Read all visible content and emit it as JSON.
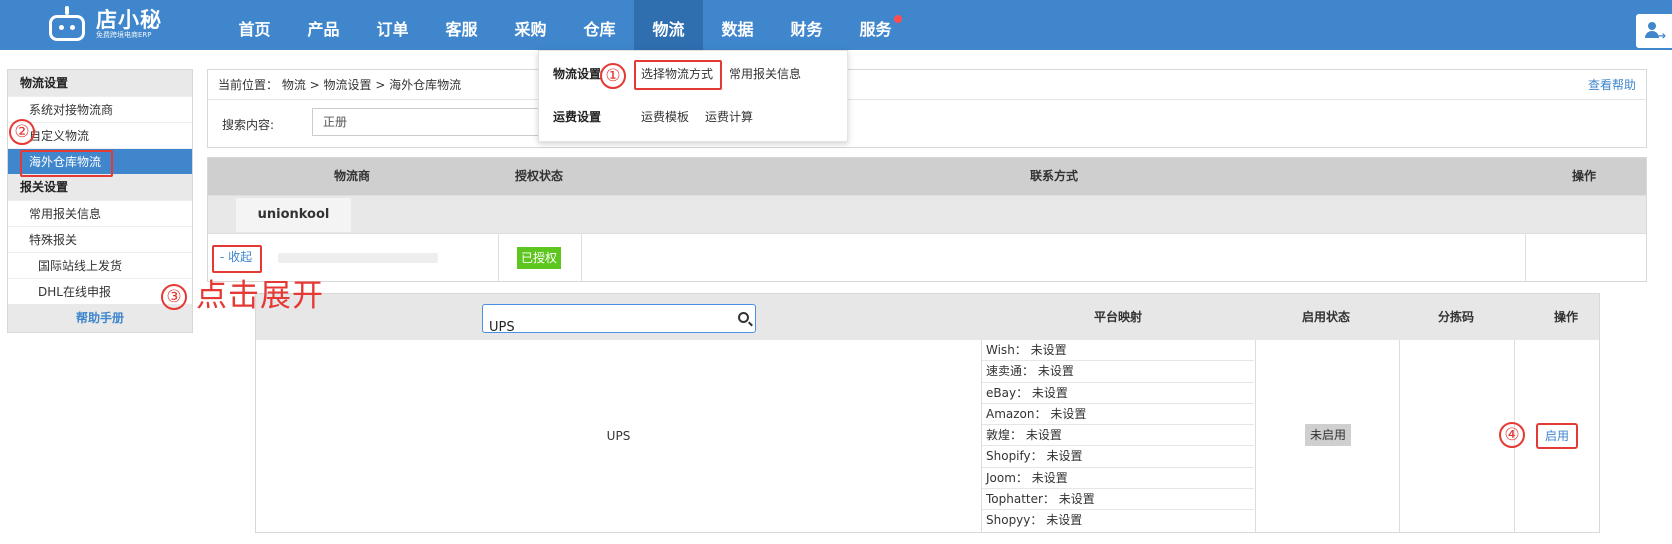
{
  "app": {
    "logo_text": "店小秘",
    "logo_sub": "免费跨境电商ERP"
  },
  "nav": {
    "items": [
      "首页",
      "产品",
      "订单",
      "客服",
      "采购",
      "仓库",
      "物流",
      "数据",
      "财务",
      "服务"
    ],
    "active": "物流"
  },
  "dropdown": {
    "group1_title": "物流设置",
    "group1_links": [
      "选择物流方式",
      "常用报关信息"
    ],
    "group2_title": "运费设置",
    "group2_links": [
      "运费模板",
      "运费计算"
    ]
  },
  "sidebar": {
    "group1": "物流设置",
    "group1_items": [
      "系统对接物流商",
      "自定义物流",
      "海外仓库物流"
    ],
    "group2": "报关设置",
    "group2_items": [
      "常用报关信息",
      "特殊报关"
    ],
    "group2_sub_items": [
      "国际站线上发货",
      "DHL在线申报"
    ],
    "help": "帮助手册"
  },
  "breadcrumb": {
    "text": "当前位置： 物流 > 物流设置 > 海外仓库物流",
    "help_link": "查看帮助"
  },
  "search": {
    "label": "搜索内容:",
    "value": "正册"
  },
  "provider_table": {
    "headers": [
      "物流商",
      "授权状态",
      "联系方式",
      "操作"
    ],
    "provider_name": "unionkool",
    "collapse_label": "- 收起",
    "auth_status": "已授权"
  },
  "ship_table": {
    "search_value": "UPS",
    "headers": [
      "平台映射",
      "启用状态",
      "分拣码",
      "操作"
    ],
    "method_name": "UPS",
    "mappings": [
      "Wish： 未设置",
      "速卖通： 未设置",
      "eBay： 未设置",
      "Amazon： 未设置",
      "敦煌： 未设置",
      "Shopify： 未设置",
      "Joom： 未设置",
      "Tophatter： 未设置",
      "Shopyy： 未设置"
    ],
    "status": "未启用",
    "action": "启用"
  },
  "annotations": {
    "step1": "①",
    "step2": "②",
    "step3": "③",
    "step3_text": "点击展开",
    "step4": "④"
  },
  "colors": {
    "primary": "#3f86cc",
    "nav_active": "#2f6fb0",
    "authorized": "#5cc51e",
    "annotation": "#e53935"
  }
}
